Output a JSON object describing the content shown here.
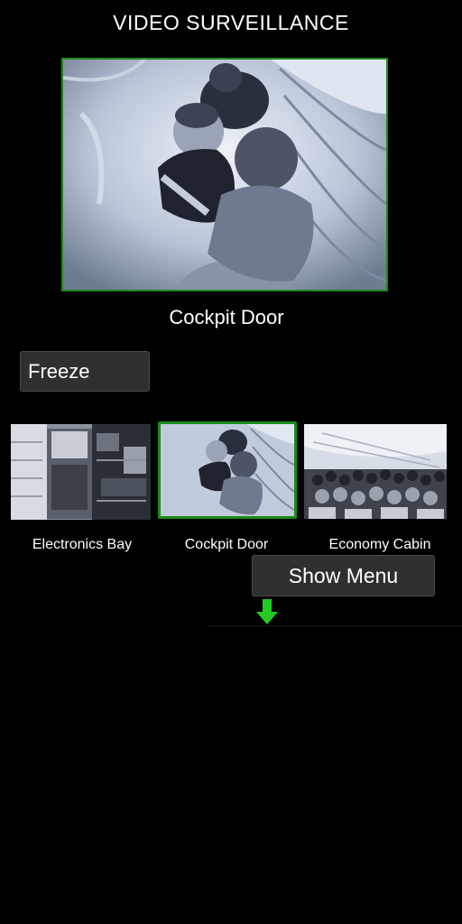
{
  "header": {
    "title": "VIDEO SURVEILLANCE"
  },
  "main_feed": {
    "caption": "Cockpit Door",
    "image": "cockpit-door-camera-feed"
  },
  "controls": {
    "freeze_label": "Freeze",
    "show_menu_label": "Show Menu",
    "arrow_icon": "arrow-down-icon"
  },
  "cameras": [
    {
      "label": "Electronics Bay",
      "image": "electronics-bay-feed",
      "selected": false
    },
    {
      "label": "Cockpit Door",
      "image": "cockpit-door-feed",
      "selected": true
    },
    {
      "label": "Economy Cabin",
      "image": "economy-cabin-feed",
      "selected": false
    }
  ],
  "colors": {
    "background": "#000000",
    "selection_border": "#1c8a1c",
    "button_bg": "#2f2f2f",
    "arrow": "#22cc22"
  }
}
